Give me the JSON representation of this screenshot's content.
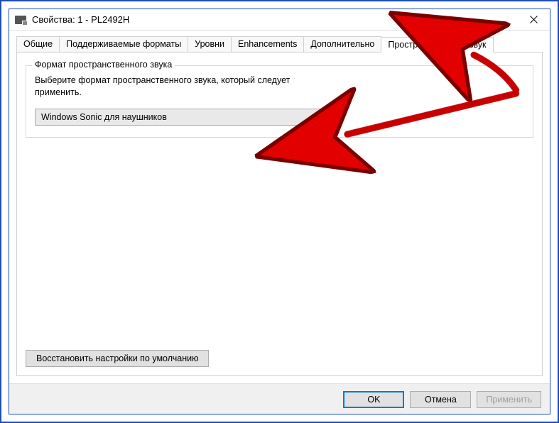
{
  "window": {
    "title": "Свойства: 1 - PL2492H"
  },
  "tabs": [
    {
      "label": "Общие",
      "active": false
    },
    {
      "label": "Поддерживаемые форматы",
      "active": false
    },
    {
      "label": "Уровни",
      "active": false
    },
    {
      "label": "Enhancements",
      "active": false
    },
    {
      "label": "Дополнительно",
      "active": false
    },
    {
      "label": "Пространственный звук",
      "active": true
    }
  ],
  "groupbox": {
    "title": "Формат пространственного звука",
    "description": "Выберите формат пространственного звука, который следует применить."
  },
  "dropdown": {
    "selected": "Windows Sonic для наушников"
  },
  "buttons": {
    "restore": "Восстановить настройки по умолчанию",
    "ok": "OK",
    "cancel": "Отмена",
    "apply": "Применить"
  }
}
